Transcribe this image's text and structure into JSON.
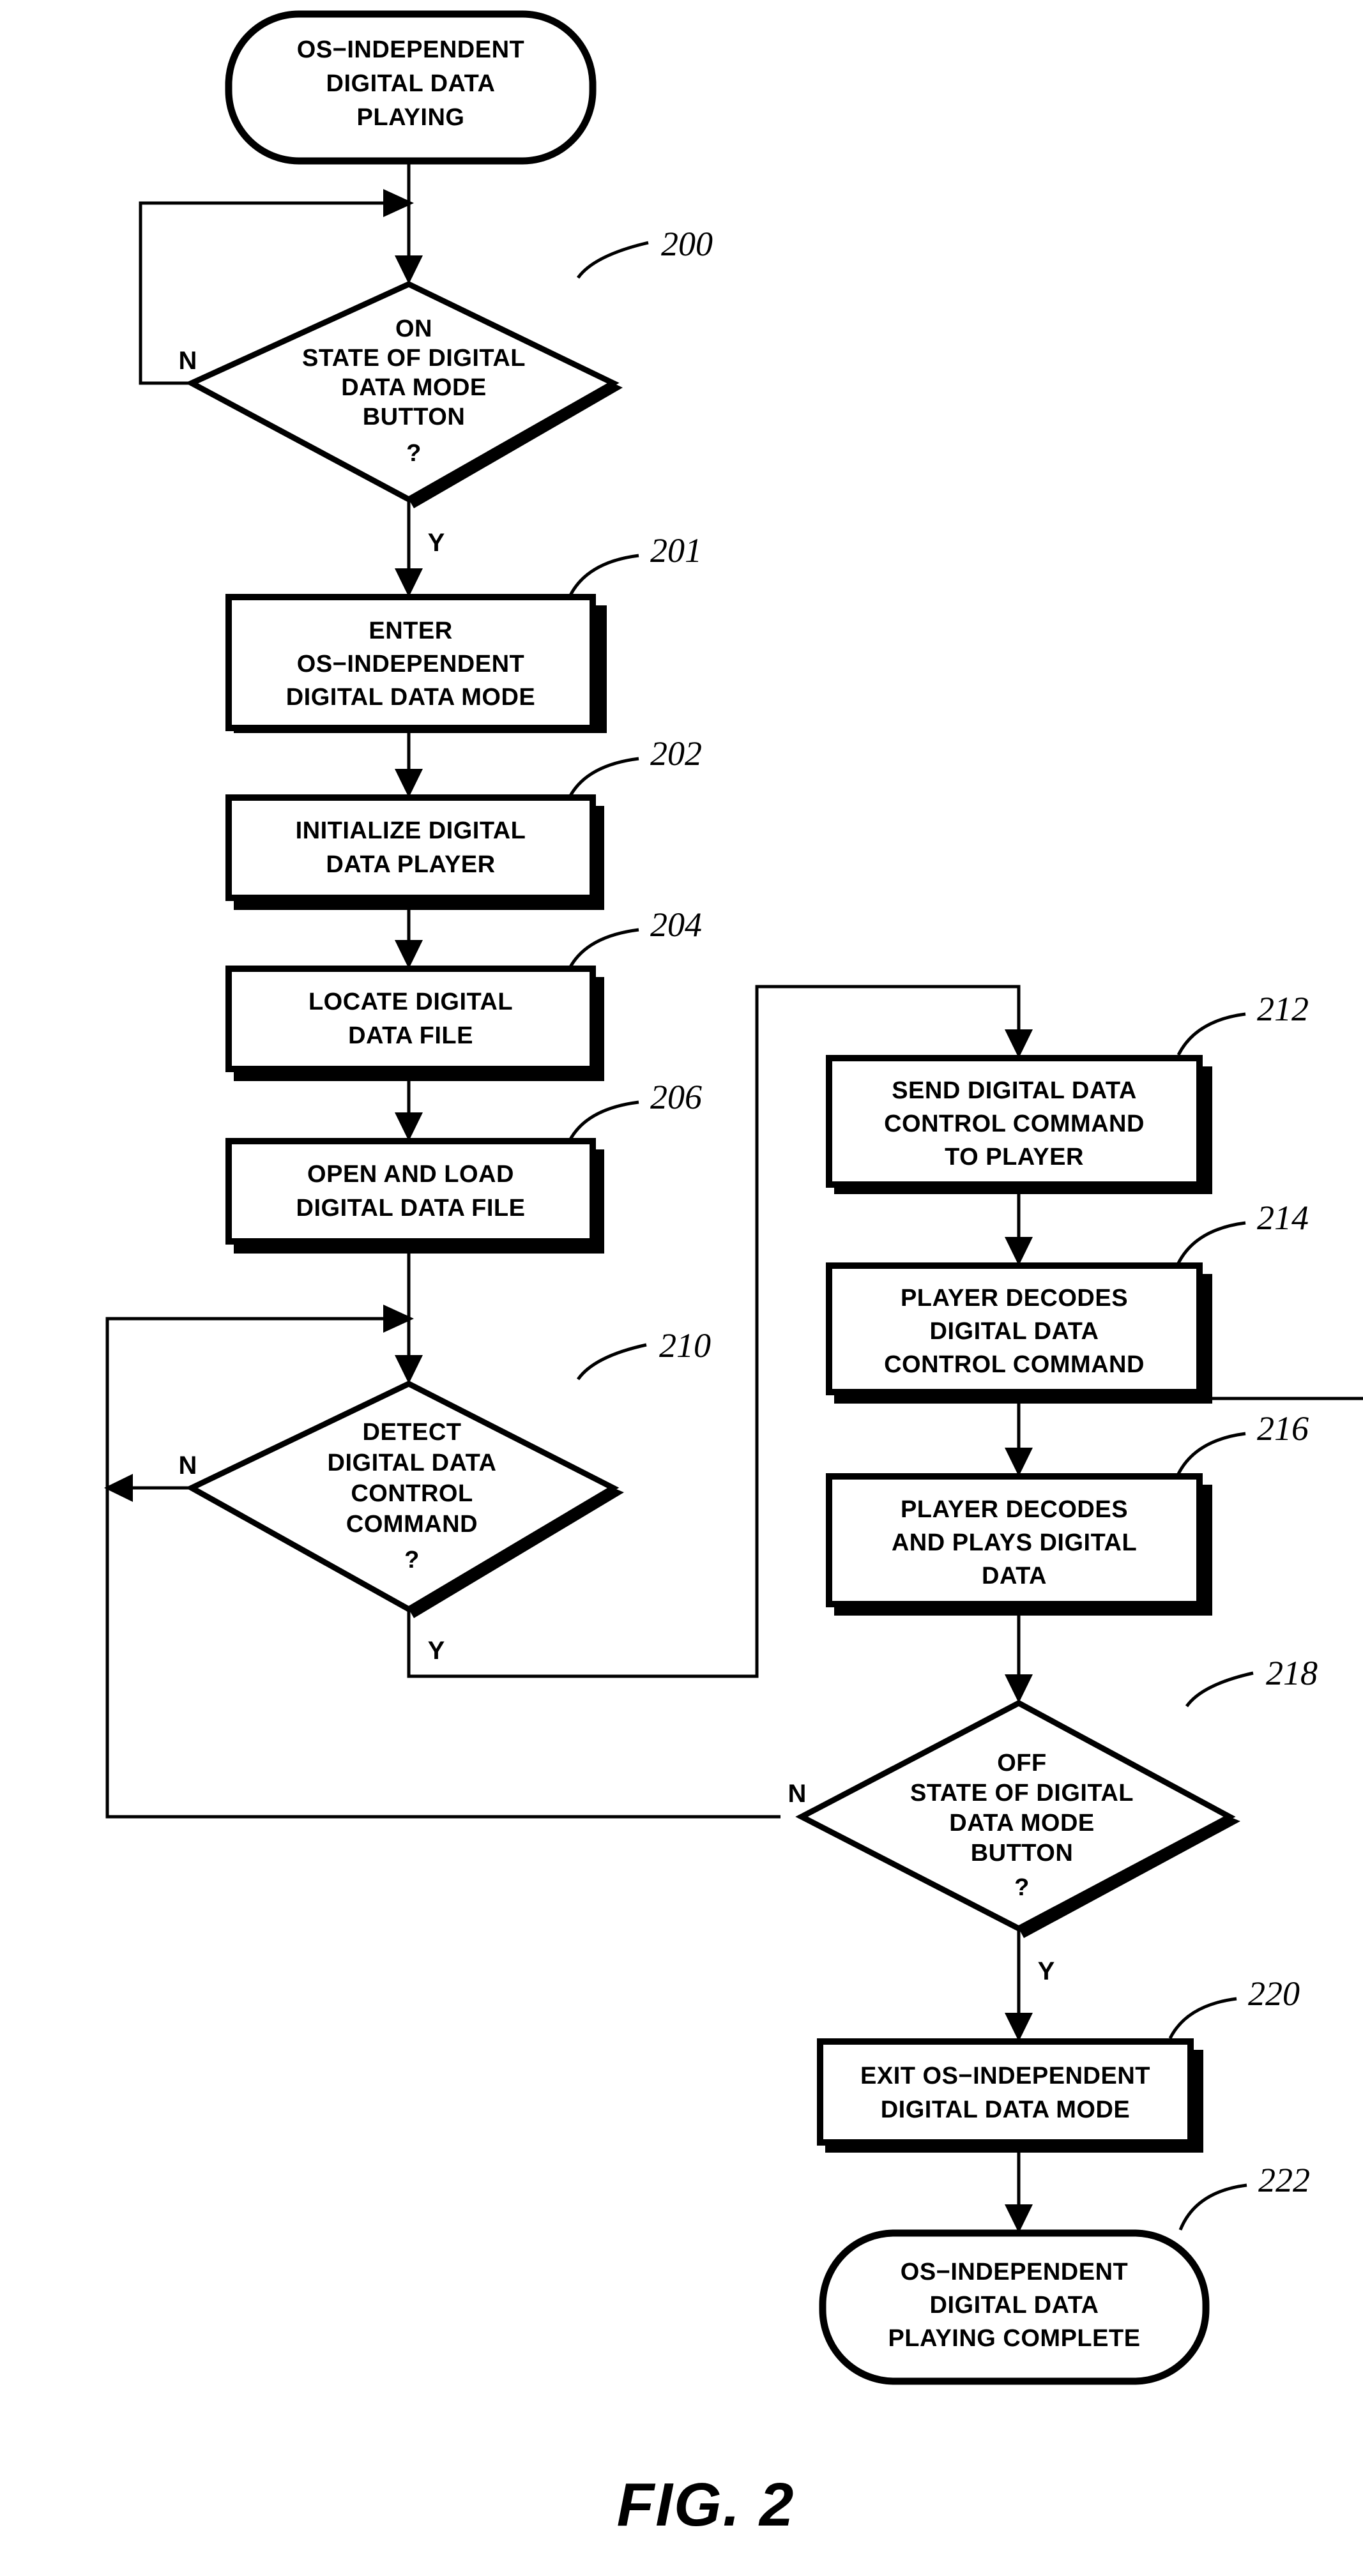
{
  "figure": {
    "caption": "FIG. 2",
    "title": "OS-Independent Digital Data Playing"
  },
  "nodes": {
    "start": {
      "ref": "",
      "shape": "terminator",
      "lines": [
        "OS−INDEPENDENT",
        "DIGITAL DATA",
        "PLAYING"
      ]
    },
    "d200": {
      "ref": "200",
      "shape": "decision",
      "lines": [
        "ON",
        "STATE OF DIGITAL",
        "DATA MODE",
        "BUTTON",
        "?"
      ],
      "yes_label": "Y",
      "no_label": "N"
    },
    "p201": {
      "ref": "201",
      "shape": "process",
      "lines": [
        "ENTER",
        "OS−INDEPENDENT",
        "DIGITAL DATA MODE"
      ]
    },
    "p202": {
      "ref": "202",
      "shape": "process",
      "lines": [
        "INITIALIZE DIGITAL",
        "DATA PLAYER"
      ]
    },
    "p204": {
      "ref": "204",
      "shape": "process",
      "lines": [
        "LOCATE DIGITAL",
        "DATA FILE"
      ]
    },
    "p206": {
      "ref": "206",
      "shape": "process",
      "lines": [
        "OPEN AND LOAD",
        "DIGITAL DATA FILE"
      ]
    },
    "d210": {
      "ref": "210",
      "shape": "decision",
      "lines": [
        "DETECT",
        "DIGITAL DATA",
        "CONTROL",
        "COMMAND",
        "?"
      ],
      "yes_label": "Y",
      "no_label": "N"
    },
    "p212": {
      "ref": "212",
      "shape": "process",
      "lines": [
        "SEND DIGITAL DATA",
        "CONTROL COMMAND",
        "TO PLAYER"
      ]
    },
    "p214": {
      "ref": "214",
      "shape": "process",
      "lines": [
        "PLAYER DECODES",
        "DIGITAL DATA",
        "CONTROL COMMAND"
      ]
    },
    "p216": {
      "ref": "216",
      "shape": "process",
      "lines": [
        "PLAYER DECODES",
        "AND PLAYS DIGITAL",
        "DATA"
      ]
    },
    "d218": {
      "ref": "218",
      "shape": "decision",
      "lines": [
        "OFF",
        "STATE OF DIGITAL",
        "DATA MODE",
        "BUTTON",
        "?"
      ],
      "yes_label": "Y",
      "no_label": "N"
    },
    "p220": {
      "ref": "220",
      "shape": "process",
      "lines": [
        "EXIT OS−INDEPENDENT",
        "DIGITAL DATA MODE"
      ]
    },
    "end222": {
      "ref": "222",
      "shape": "terminator",
      "lines": [
        "OS−INDEPENDENT",
        "DIGITAL DATA",
        "PLAYING COMPLETE"
      ]
    }
  },
  "colors": {
    "ink": "#000000",
    "paper": "#ffffff"
  },
  "chart_data": {
    "type": "flowchart",
    "title": "FIG. 2",
    "nodes": [
      {
        "id": "start",
        "ref": "",
        "type": "terminator",
        "text": "OS-INDEPENDENT DIGITAL DATA PLAYING"
      },
      {
        "id": "200",
        "ref": "200",
        "type": "decision",
        "text": "ON STATE OF DIGITAL DATA MODE BUTTON ?"
      },
      {
        "id": "201",
        "ref": "201",
        "type": "process",
        "text": "ENTER OS-INDEPENDENT DIGITAL DATA MODE"
      },
      {
        "id": "202",
        "ref": "202",
        "type": "process",
        "text": "INITIALIZE DIGITAL DATA PLAYER"
      },
      {
        "id": "204",
        "ref": "204",
        "type": "process",
        "text": "LOCATE DIGITAL DATA FILE"
      },
      {
        "id": "206",
        "ref": "206",
        "type": "process",
        "text": "OPEN AND LOAD DIGITAL DATA FILE"
      },
      {
        "id": "210",
        "ref": "210",
        "type": "decision",
        "text": "DETECT DIGITAL DATA CONTROL COMMAND ?"
      },
      {
        "id": "212",
        "ref": "212",
        "type": "process",
        "text": "SEND DIGITAL DATA CONTROL COMMAND TO PLAYER"
      },
      {
        "id": "214",
        "ref": "214",
        "type": "process",
        "text": "PLAYER DECODES DIGITAL DATA CONTROL COMMAND"
      },
      {
        "id": "216",
        "ref": "216",
        "type": "process",
        "text": "PLAYER DECODES AND PLAYS DIGITAL DATA"
      },
      {
        "id": "218",
        "ref": "218",
        "type": "decision",
        "text": "OFF STATE OF DIGITAL DATA MODE BUTTON ?"
      },
      {
        "id": "220",
        "ref": "220",
        "type": "process",
        "text": "EXIT OS-INDEPENDENT DIGITAL DATA MODE"
      },
      {
        "id": "222",
        "ref": "222",
        "type": "terminator",
        "text": "OS-INDEPENDENT DIGITAL DATA PLAYING COMPLETE"
      }
    ],
    "edges": [
      {
        "from": "start",
        "to": "200",
        "label": ""
      },
      {
        "from": "200",
        "to": "200",
        "label": "N"
      },
      {
        "from": "200",
        "to": "201",
        "label": "Y"
      },
      {
        "from": "201",
        "to": "202",
        "label": ""
      },
      {
        "from": "202",
        "to": "204",
        "label": ""
      },
      {
        "from": "204",
        "to": "206",
        "label": ""
      },
      {
        "from": "206",
        "to": "210",
        "label": ""
      },
      {
        "from": "210",
        "to": "210",
        "label": "N"
      },
      {
        "from": "210",
        "to": "212",
        "label": "Y"
      },
      {
        "from": "212",
        "to": "214",
        "label": ""
      },
      {
        "from": "214",
        "to": "216",
        "label": ""
      },
      {
        "from": "216",
        "to": "218",
        "label": ""
      },
      {
        "from": "218",
        "to": "210",
        "label": "N"
      },
      {
        "from": "218",
        "to": "220",
        "label": "Y"
      },
      {
        "from": "220",
        "to": "222",
        "label": ""
      }
    ]
  }
}
